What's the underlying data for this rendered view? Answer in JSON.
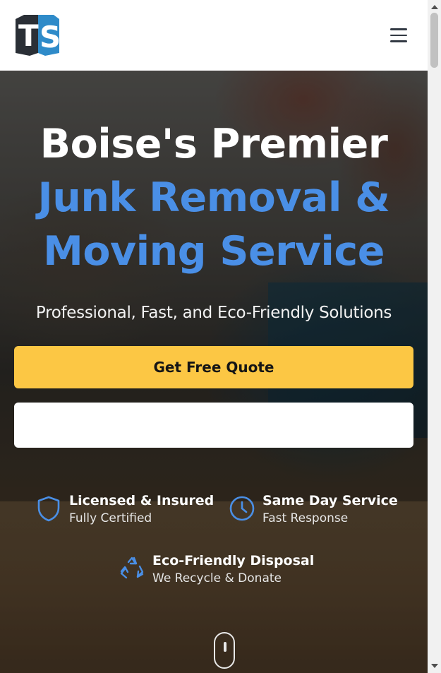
{
  "header": {
    "logo_text": "TS",
    "menu_icon": "hamburger-menu-icon"
  },
  "hero": {
    "title_line1": "Boise's Premier",
    "title_line2": "Junk Removal &",
    "title_line3": "Moving Service",
    "subtitle": "Professional, Fast, and Eco-Friendly Solutions",
    "cta_label": "Get Free Quote",
    "secondary_cta_label": ""
  },
  "features": [
    {
      "icon": "shield-icon",
      "title": "Licensed & Insured",
      "subtitle": "Fully Certified"
    },
    {
      "icon": "clock-icon",
      "title": "Same Day Service",
      "subtitle": "Fast Response"
    },
    {
      "icon": "recycle-icon",
      "title": "Eco-Friendly Disposal",
      "subtitle": "We Recycle & Donate"
    }
  ],
  "colors": {
    "accent_blue": "#4a8fe6",
    "cta_yellow": "#fcc744",
    "logo_dark": "#2a2f36",
    "logo_blue": "#2f8bc9"
  }
}
